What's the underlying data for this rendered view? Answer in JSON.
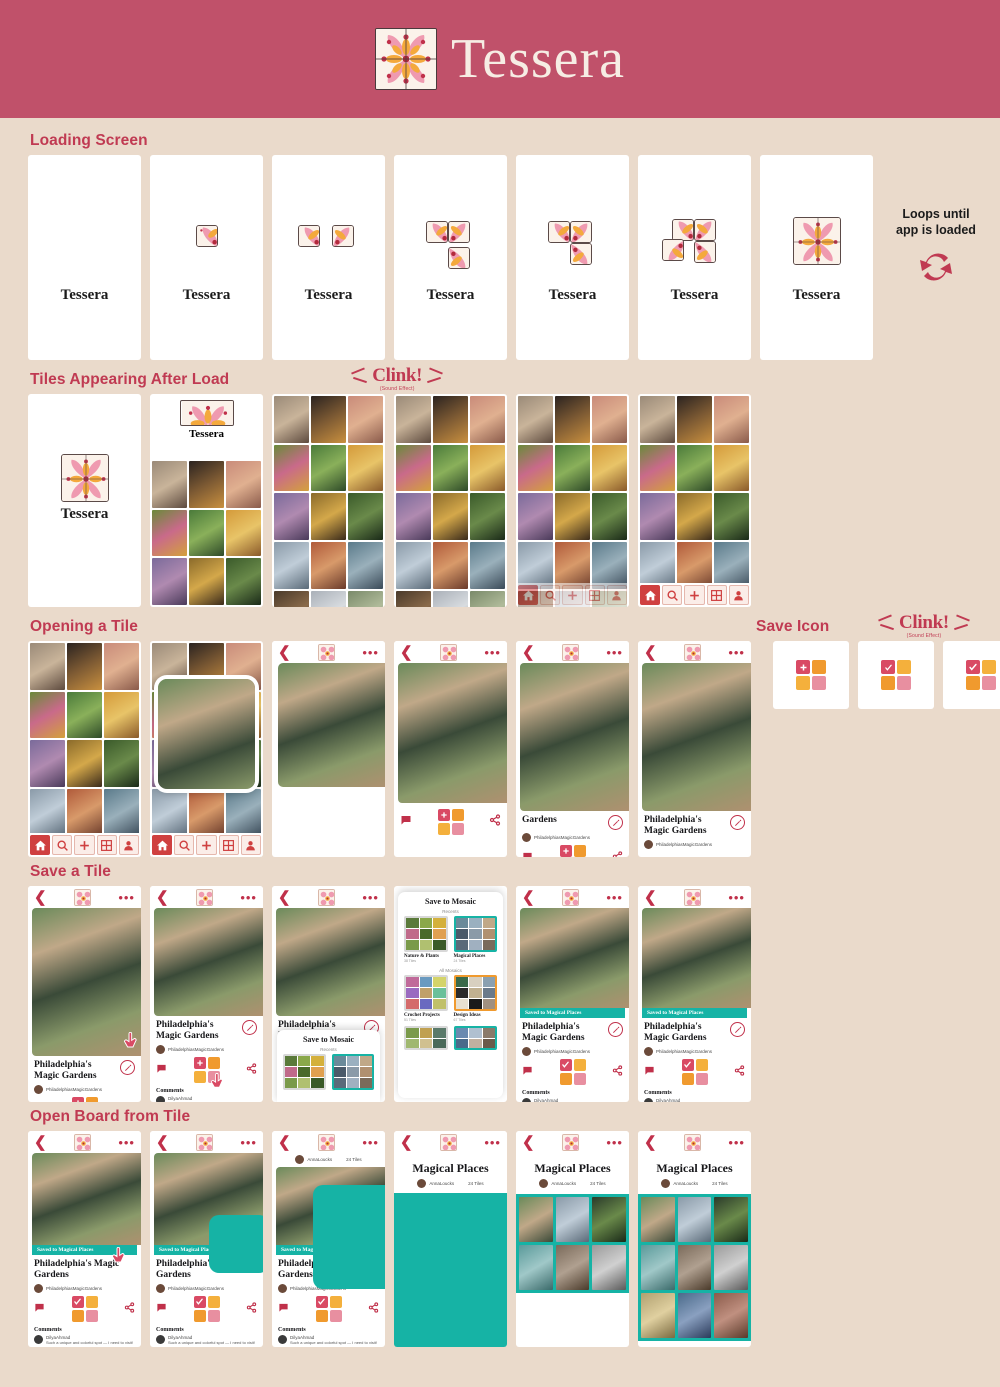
{
  "header": {
    "app_name": "Tessera",
    "logo_icon": "tessera-tile-logo"
  },
  "sections": [
    {
      "id": "loading",
      "title": "Loading Screen"
    },
    {
      "id": "tiles_after_load",
      "title": "Tiles Appearing After Load"
    },
    {
      "id": "opening_tile",
      "title": "Opening a Tile"
    },
    {
      "id": "save_tile",
      "title": "Save a Tile"
    },
    {
      "id": "open_board",
      "title": "Open Board from Tile"
    }
  ],
  "loading": {
    "word": "Tessera",
    "frames": [
      {
        "quads": 0
      },
      {
        "quads": 1
      },
      {
        "quads": 2
      },
      {
        "quads": 3
      },
      {
        "quads": 3
      },
      {
        "quads": 4
      },
      {
        "quads": 4
      }
    ],
    "loop_note_line1": "Loops until",
    "loop_note_line2": "app is loaded",
    "loop_icon": "refresh-loop-icon"
  },
  "clink": {
    "word": "Clink!",
    "subtitle": "(Sound Effect)"
  },
  "save_icon_panel": {
    "title": "Save Icon",
    "states": [
      "plus",
      "heart-partial",
      "check"
    ]
  },
  "nav": {
    "items": [
      {
        "name": "home",
        "icon": "home-icon",
        "active": true
      },
      {
        "name": "search",
        "icon": "search-icon",
        "active": false
      },
      {
        "name": "create",
        "icon": "plus-icon",
        "active": false
      },
      {
        "name": "boards",
        "icon": "grid-icon",
        "active": false
      },
      {
        "name": "profile",
        "icon": "person-icon",
        "active": false
      }
    ]
  },
  "detail": {
    "title": "Philadelphia's Magic Gardens",
    "title_short": "Gardens",
    "username": "PhiladelphiasMagicGardens",
    "back_icon": "chevron-left-icon",
    "more_icon": "more-dots-icon",
    "edit_icon": "pencil-icon",
    "comment_icon": "comment-icon",
    "share_icon": "share-icon",
    "save_icon": "save-mosaic-icon",
    "comments_heading": "Comments",
    "comment_user": "DilyaAhmad",
    "comment_text": "Such a unique and colorful spot — I need to visit!",
    "saved_banner": "Saved to Magical Places"
  },
  "save_modal": {
    "heading": "Save to Mosaic",
    "recents_label": "Recents",
    "all_label": "All Mosaics",
    "recents": [
      {
        "name": "Nature & Plants",
        "count": "38 Tiles",
        "border": "#d8d8d8"
      },
      {
        "name": "Magical Places",
        "count": "24 Tiles",
        "border": "#16B3A5"
      }
    ],
    "all": [
      {
        "name": "Crochet Projects",
        "count": "51 Tiles",
        "border": "#d8d8d8"
      },
      {
        "name": "Design Ideas",
        "count": "67 Tiles",
        "border": "#F09A2E"
      }
    ]
  },
  "board": {
    "title": "Magical Places",
    "username": "AnnaLoucks",
    "tile_count": "24 Tiles"
  },
  "colors": {
    "header_bg": "#C0516A",
    "page_bg": "#EADACB",
    "accent_red": "#C03A52",
    "nav_active": "#CF4040",
    "teal": "#16B3A5",
    "orange": "#F09A2E",
    "phone_bg": "#FFFFFF"
  }
}
